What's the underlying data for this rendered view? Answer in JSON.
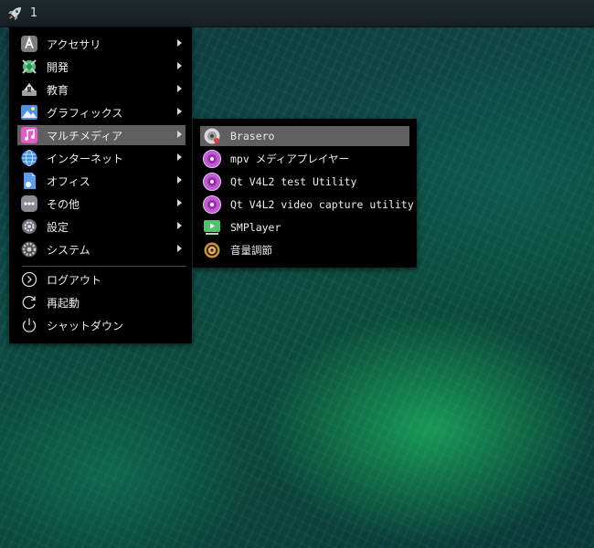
{
  "taskbar": {
    "workspace": "1"
  },
  "main_menu": {
    "items": [
      {
        "label": "アクセサリ",
        "icon": "accessories-icon",
        "submenu": true
      },
      {
        "label": "開発",
        "icon": "development-icon",
        "submenu": true
      },
      {
        "label": "教育",
        "icon": "education-icon",
        "submenu": true
      },
      {
        "label": "グラフィックス",
        "icon": "graphics-icon",
        "submenu": true
      },
      {
        "label": "マルチメディア",
        "icon": "multimedia-icon",
        "submenu": true,
        "selected": true
      },
      {
        "label": "インターネット",
        "icon": "internet-icon",
        "submenu": true
      },
      {
        "label": "オフィス",
        "icon": "office-icon",
        "submenu": true
      },
      {
        "label": "その他",
        "icon": "other-icon",
        "submenu": true
      },
      {
        "label": "設定",
        "icon": "settings-icon",
        "submenu": true
      },
      {
        "label": "システム",
        "icon": "system-icon",
        "submenu": true
      }
    ],
    "session": [
      {
        "label": "ログアウト",
        "icon": "logout-icon"
      },
      {
        "label": "再起動",
        "icon": "reboot-icon"
      },
      {
        "label": "シャットダウン",
        "icon": "shutdown-icon"
      }
    ]
  },
  "multimedia_submenu": {
    "items": [
      {
        "label": "Brasero",
        "icon": "brasero-icon",
        "selected": true
      },
      {
        "label": "mpv メディアプレイヤー",
        "icon": "mpv-icon"
      },
      {
        "label": "Qt V4L2 test Utility",
        "icon": "qv4l2-icon"
      },
      {
        "label": "Qt V4L2 video capture utility",
        "icon": "qvidcap-icon"
      },
      {
        "label": "SMPlayer",
        "icon": "smplayer-icon"
      },
      {
        "label": "音量調節",
        "icon": "volume-control-icon"
      }
    ]
  },
  "colors": {
    "menu_bg": "#000000",
    "selected_bg": "#5f5f5f",
    "multimedia_selected": "#c040b0"
  }
}
